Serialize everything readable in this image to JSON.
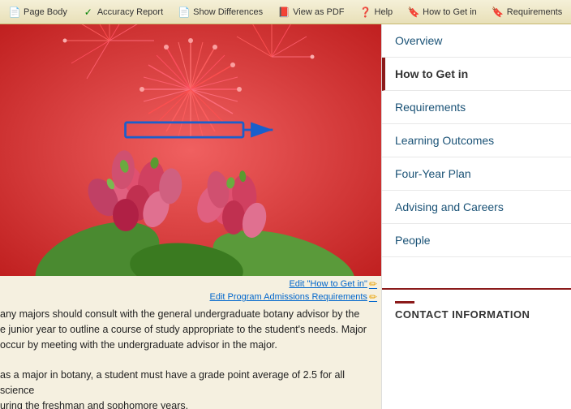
{
  "toolbar": {
    "items": [
      {
        "label": "Page Body",
        "icon": "📄"
      },
      {
        "label": "Accuracy Report",
        "icon": "✓"
      },
      {
        "label": "Show Differences",
        "icon": "📄"
      },
      {
        "label": "View as PDF",
        "icon": "📕"
      },
      {
        "label": "Help",
        "icon": "❓"
      },
      {
        "label": "How to Get in",
        "icon": "🔖"
      },
      {
        "label": "Requirements",
        "icon": "🔖"
      }
    ]
  },
  "sidebar": {
    "items": [
      {
        "label": "Overview",
        "active": false
      },
      {
        "label": "How to Get in",
        "active": true
      },
      {
        "label": "Requirements",
        "active": false
      },
      {
        "label": "Learning Outcomes",
        "active": false
      },
      {
        "label": "Four-Year Plan",
        "active": false
      },
      {
        "label": "Advising and Careers",
        "active": false
      },
      {
        "label": "People",
        "active": false
      }
    ],
    "contact_header": "CONTACT INFORMATION"
  },
  "edit_links": {
    "link1": "Edit \"How to Get in\"",
    "link2": "Edit Program Admissions Requirements"
  },
  "body_paragraphs": [
    "any majors should consult with the general undergraduate botany advisor by the",
    "e junior year to outline a course of study appropriate to the student's needs. Major",
    "occur by meeting with the undergraduate advisor in the major.",
    "",
    "as a major in botany, a student must have a grade point average of 2.5 for all science",
    "uring the freshman and sophomore years."
  ]
}
